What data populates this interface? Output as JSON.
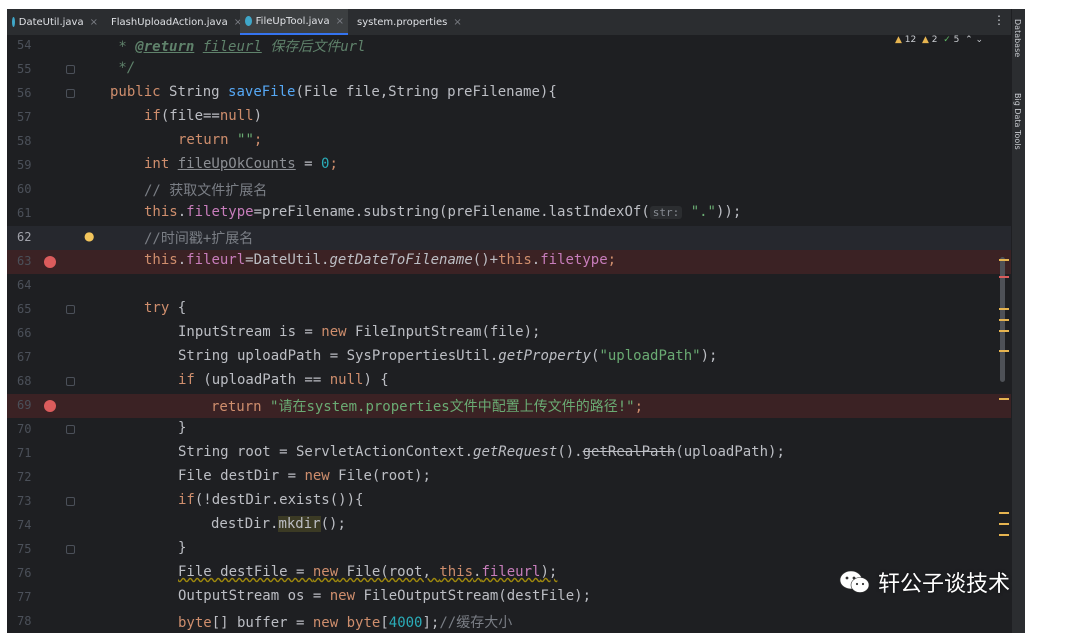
{
  "tabs": [
    {
      "label": "DateUtil.java",
      "active": false
    },
    {
      "label": "FlashUploadAction.java",
      "active": false
    },
    {
      "label": "FileUpTool.java",
      "active": true
    },
    {
      "label": "system.properties",
      "active": false
    }
  ],
  "inspections": {
    "warnings": "12",
    "weak_warnings": "2",
    "ok": "5"
  },
  "right_panel": {
    "database": "Database",
    "big_data_tools": "Big Data Tools"
  },
  "watermark": "轩公子谈技术",
  "lines": {
    "n54": "54",
    "n55": "55",
    "n56": "56",
    "n57": "57",
    "n58": "58",
    "n59": "59",
    "n60": "60",
    "n61": "61",
    "n62": "62",
    "n63": "63",
    "n64": "64",
    "n65": "65",
    "n66": "66",
    "n67": "67",
    "n68": "68",
    "n69": "69",
    "n70": "70",
    "n71": "71",
    "n72": "72",
    "n73": "73",
    "n74": "74",
    "n75": "75",
    "n76": "76",
    "n77": "77",
    "n78": "78"
  },
  "code": {
    "l54_star": " * ",
    "l54_tag": "@return",
    "l54_name": "fileurl",
    "l54_desc": " 保存后文件url",
    "l55": " */",
    "l56_kw": "public ",
    "l56_type": "String ",
    "l56_fn": "saveFile",
    "l56_rest": "(File file,String preFilename){",
    "l57_kw": "if",
    "l57_a": "(file==",
    "l57_null": "null",
    "l57_b": ")",
    "l58_kw": "return ",
    "l58_str": "\"\"",
    "l58_end": ";",
    "l59_kw": "int ",
    "l59_var": "fileUpOkCounts",
    "l59_eq": " = ",
    "l59_num": "0",
    "l59_end": ";",
    "l60": "// 获取文件扩展名",
    "l61_this": "this",
    "l61_dot": ".",
    "l61_fld": "filetype",
    "l61_rest": "=preFilename.substring(preFilename.lastIndexOf(",
    "l61_hint": "str:",
    "l61_str": "\".\"",
    "l61_end": "));",
    "l62": "//时间戳+扩展名",
    "l63_this": "this",
    "l63_dot": ".",
    "l63_fld": "fileurl",
    "l63_a": "=DateUtil.",
    "l63_m": "getDateToFilename",
    "l63_b": "()+",
    "l63_this2": "this",
    "l63_dot2": ".",
    "l63_fld2": "filetype",
    "l63_end": ";",
    "l65_kw": "try",
    "l65_rest": " {",
    "l66_a": "InputStream is = ",
    "l66_kw": "new",
    "l66_b": " FileInputStream(file);",
    "l67_a": "String uploadPath = SysPropertiesUtil.",
    "l67_m": "getProperty",
    "l67_b": "(",
    "l67_str": "\"uploadPath\"",
    "l67_c": ");",
    "l68_kw": "if",
    "l68_a": " (uploadPath == ",
    "l68_null": "null",
    "l68_b": ") {",
    "l69_kw": "return ",
    "l69_str": "\"请在system.properties文件中配置上传文件的路径!\"",
    "l69_end": ";",
    "l70": "}",
    "l71_a": "String root = ServletActionContext.",
    "l71_m": "getRequest",
    "l71_b": "().",
    "l71_dep": "getRealPath",
    "l71_c": "(uploadPath);",
    "l72_a": "File destDir = ",
    "l72_kw": "new",
    "l72_b": " File(root);",
    "l73_kw": "if",
    "l73_rest": "(!destDir.exists()){",
    "l74_a": "destDir.",
    "l74_m": "mkdir",
    "l74_b": "();",
    "l75": "}",
    "l76_a": "File destFile = ",
    "l76_kw": "new",
    "l76_b": " File(root, ",
    "l76_this": "this",
    "l76_c": ".",
    "l76_fld": "fileurl",
    "l76_d": ");",
    "l77_a": "OutputStream os = ",
    "l77_kw": "new",
    "l77_b": " FileOutputStream(destFile);",
    "l78_kw": "byte",
    "l78_a": "[] buffer = ",
    "l78_kw2": "new",
    "l78_b": " ",
    "l78_kw3": "byte",
    "l78_c": "[",
    "l78_num": "4000",
    "l78_d": "];",
    "l78_cm": "//缓存大小"
  }
}
